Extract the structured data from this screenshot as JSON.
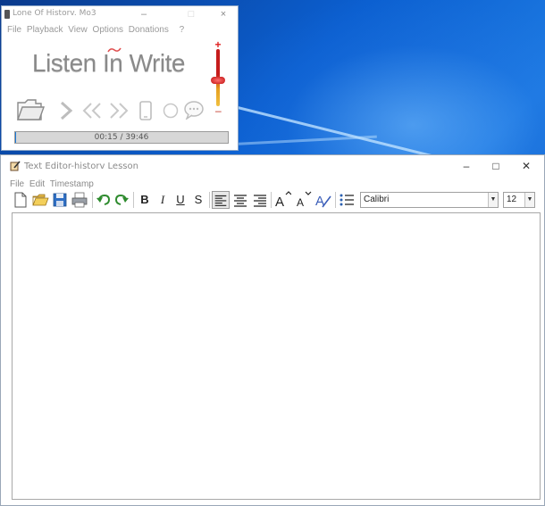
{
  "player": {
    "title": "Lone Of Historv. Mo3",
    "controls": {
      "minimize": "–",
      "maximize": "□",
      "close": "×"
    },
    "menu": [
      "File",
      "Playback",
      "View",
      "Options",
      "Donations",
      "?"
    ],
    "logo_text": "Listen In Write",
    "time_display": "00:15 / 39:46",
    "progress_fraction": 0.006,
    "volume": {
      "plus": "+",
      "minus": "–",
      "level_fraction": 0.45
    },
    "icons": [
      "open-folder-icon",
      "play-icon",
      "rewind-icon",
      "fast-forward-icon",
      "phone-icon",
      "stop-icon",
      "chat-icon"
    ]
  },
  "editor": {
    "title": "Text Editor-historv Lesson",
    "controls": {
      "minimize": "–",
      "maximize": "□",
      "close": "✕"
    },
    "menu": [
      "File",
      "Edit",
      "Timestamp"
    ],
    "toolbar": {
      "bold": "B",
      "italic": "I",
      "underline": "U",
      "strike": "S",
      "font": "Calibri",
      "size": "12"
    },
    "body_text": ""
  },
  "colors": {
    "desktop": "#0b5fd0",
    "progress_fill": "#1a7ad9",
    "volume_red": "#c51c1c"
  }
}
